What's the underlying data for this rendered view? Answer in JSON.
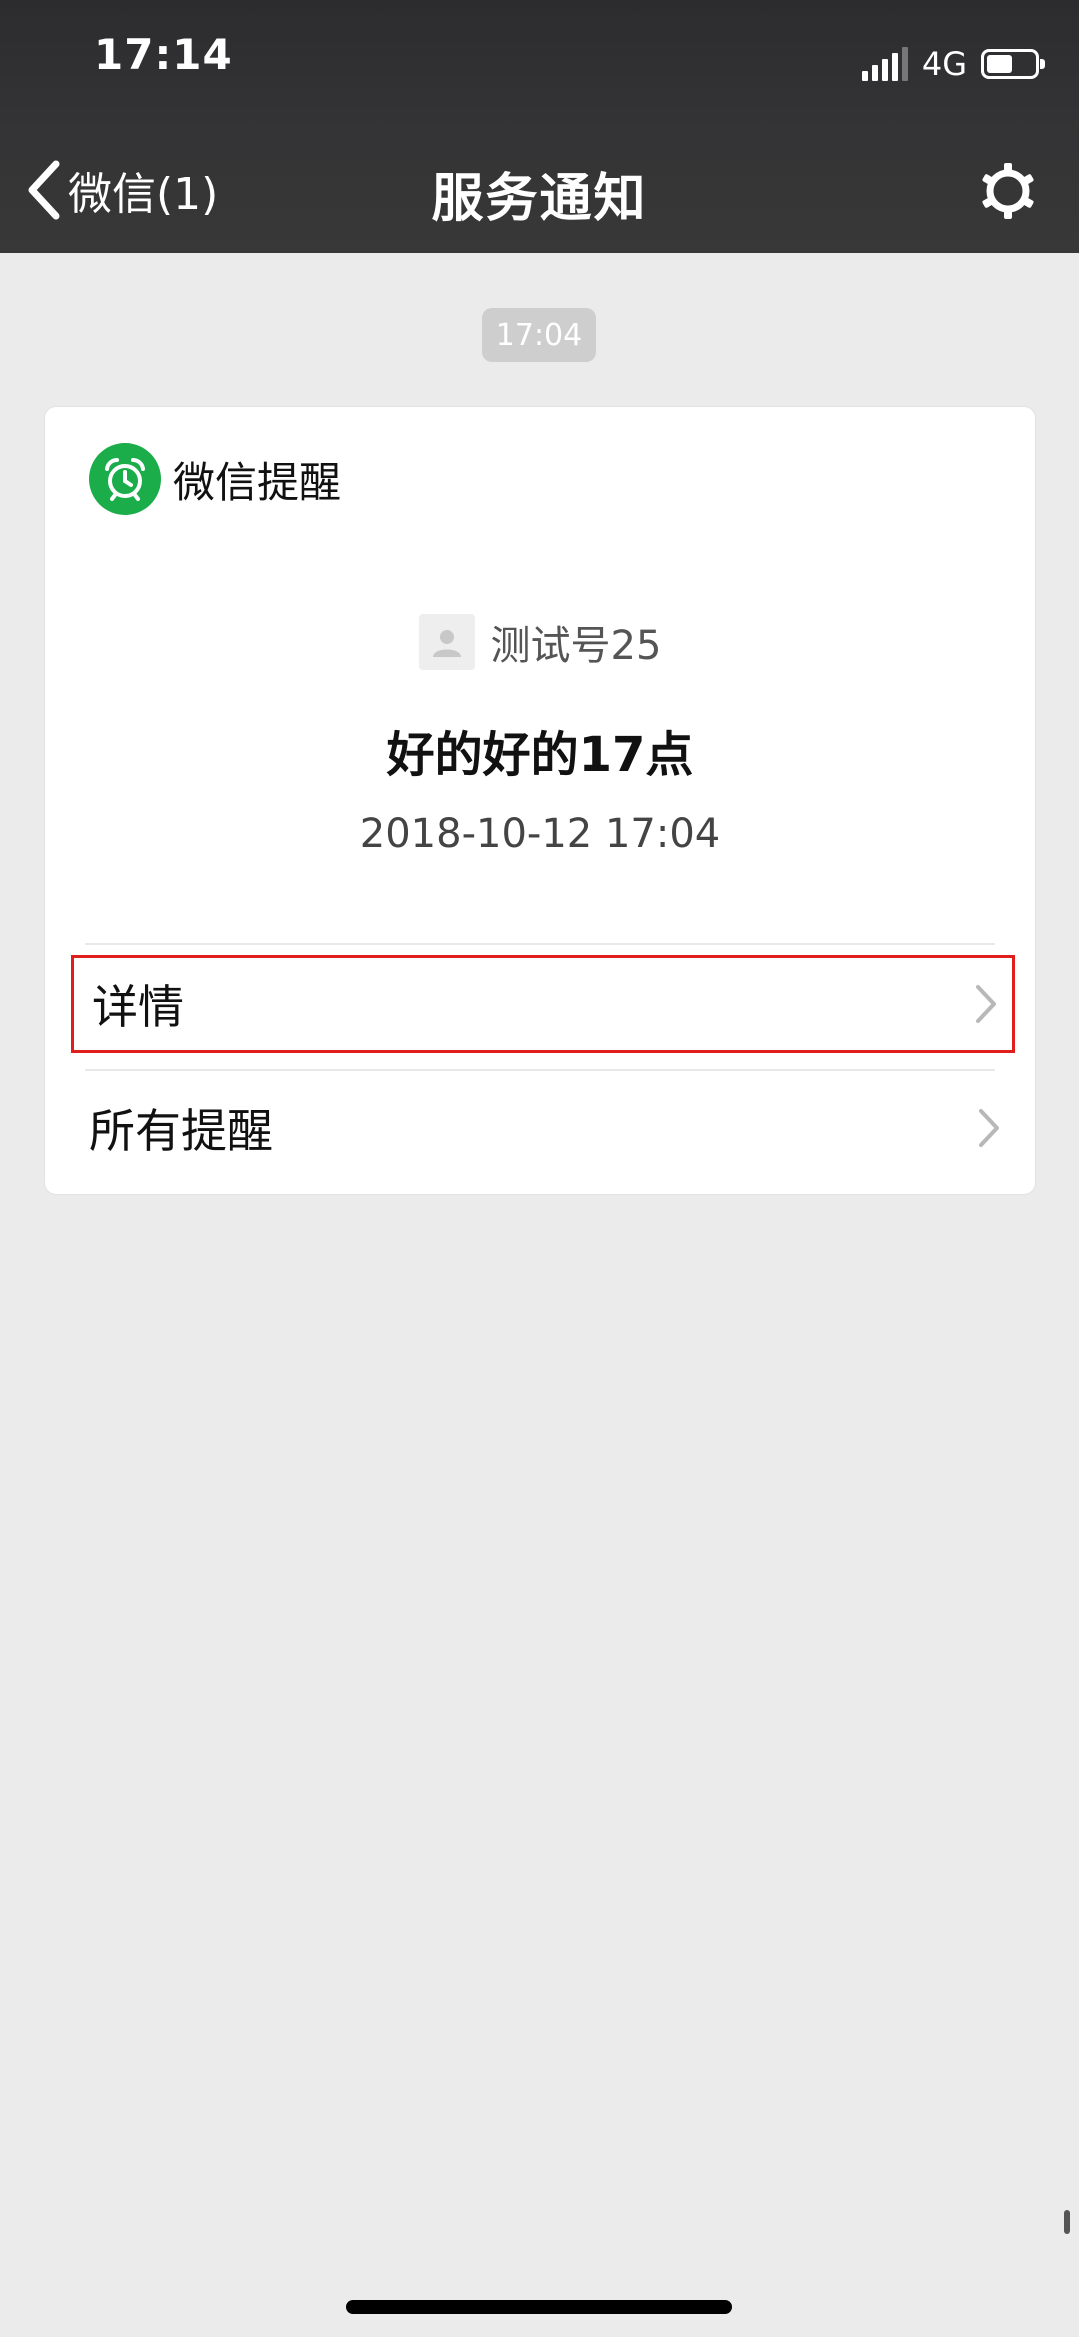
{
  "status_bar": {
    "time": "17:14",
    "network": "4G",
    "battery_level": 0.55
  },
  "nav": {
    "back_label": "微信(1)",
    "title": "服务通知",
    "settings_icon": "gear-icon"
  },
  "timestamp": "17:04",
  "card": {
    "app_name": "微信提醒",
    "app_icon": "alarm-clock-icon",
    "app_icon_color": "#1aad4a",
    "sender": "测试号25",
    "message_title": "好的好的17点",
    "message_time": "2018-10-12 17:04",
    "rows": [
      {
        "label": "详情",
        "highlighted": true
      },
      {
        "label": "所有提醒",
        "highlighted": false
      }
    ]
  },
  "colors": {
    "header_bg": "#333335",
    "page_bg": "#ebebeb",
    "highlight_border": "#e01e1e"
  }
}
